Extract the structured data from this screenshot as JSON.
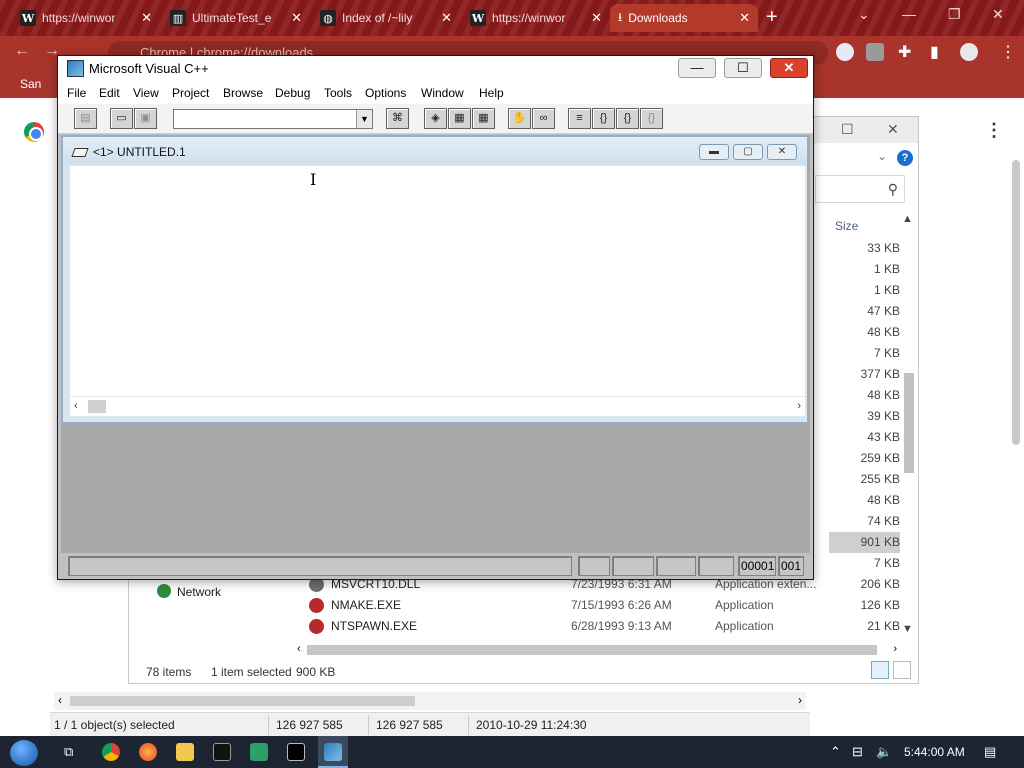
{
  "chrome": {
    "tabs": [
      {
        "label": "https://winwor",
        "icon": "W"
      },
      {
        "label": "UltimateTest_e",
        "icon": "archive-icon"
      },
      {
        "label": "Index of /~lily",
        "icon": "globe-icon"
      },
      {
        "label": "https://winwor",
        "icon": "W"
      },
      {
        "label": "Downloads",
        "icon": "download-icon"
      }
    ],
    "url": "Chrome | chrome://downloads",
    "bookmark_text": "San"
  },
  "explorer": {
    "size_header": "Size",
    "sizes": [
      "33 KB",
      "1 KB",
      "1 KB",
      "47 KB",
      "48 KB",
      "7 KB",
      "377 KB",
      "48 KB",
      "39 KB",
      "43 KB",
      "259 KB",
      "255 KB",
      "48 KB",
      "74 KB",
      "901 KB",
      "7 KB"
    ],
    "selected_size_index": 14,
    "rows": [
      {
        "name": "MSVCRT10.DLL",
        "date": "7/23/1993 6:31 AM",
        "type": "Application exten...",
        "size": "206 KB"
      },
      {
        "name": "NMAKE.EXE",
        "date": "7/15/1993 6:26 AM",
        "type": "Application",
        "size": "126 KB"
      },
      {
        "name": "NTSPAWN.EXE",
        "date": "6/28/1993 9:13 AM",
        "type": "Application",
        "size": "21 KB"
      }
    ],
    "nav_network": "Network",
    "status_items": "78 items",
    "status_selected": "1 item selected",
    "status_size": "900 KB"
  },
  "file_manager_status": {
    "selected": "1 / 1 object(s) selected",
    "size1": "126 927 585",
    "size2": "126 927 585",
    "date": "2010-10-29 11:24:30"
  },
  "vc": {
    "title": "Microsoft Visual C++",
    "menu": [
      "File",
      "Edit",
      "View",
      "Project",
      "Browse",
      "Debug",
      "Tools",
      "Options",
      "Window",
      "Help"
    ],
    "combo_value": "",
    "child_title": "<1> UNTITLED.1",
    "status_line": "00001",
    "status_col": "001"
  },
  "taskbar": {
    "clock": "5:44:00 AM"
  },
  "colors": {
    "chrome_frame": "#8b1a1a",
    "vc_gray": "#c0c0c0",
    "mdi_bg": "#a9a9a9",
    "taskbar": "#1c2531",
    "close_red": "#d9412c"
  }
}
